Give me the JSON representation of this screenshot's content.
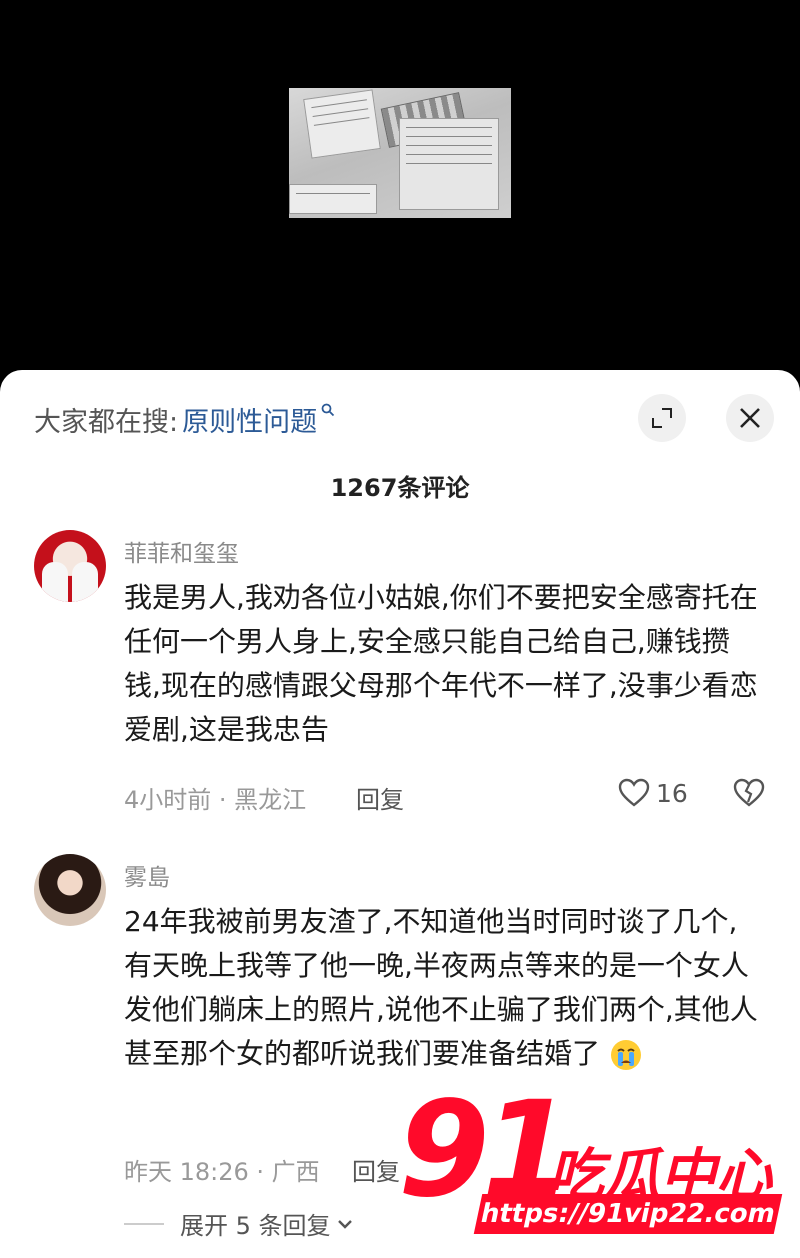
{
  "header": {
    "search_prefix": "大家都在搜:",
    "search_term": "原则性问题"
  },
  "comments_count_label": "1267条评论",
  "comments": [
    {
      "user": "菲菲和玺玺",
      "text": "我是男人,我劝各位小姑娘,你们不要把安全感寄托在任何一个男人身上,安全感只能自己给自己,赚钱攒钱,现在的感情跟父母那个年代不一样了,没事少看恋爱剧,这是我忠告",
      "meta": "4小时前 · 黑龙江",
      "reply_label": "回复",
      "likes": "16"
    },
    {
      "user": "雾島",
      "text": "24年我被前男友渣了,不知道他当时同时谈了几个,有天晚上我等了他一晚,半夜两点等来的是一个女人发他们躺床上的照片,说他不止骗了我们两个,其他人甚至那个女的都听说我们要准备结婚了",
      "emoji": "crying-face-icon",
      "meta": "昨天 18:26 · 广西",
      "reply_label": "回复"
    }
  ],
  "expand_replies_label": "展开 5 条回复",
  "watermark": {
    "number": "91",
    "title": "吃瓜中心",
    "url": "https://91vip22.com"
  },
  "colors": {
    "link": "#2c5a96",
    "watermark": "#ff0a2a"
  }
}
